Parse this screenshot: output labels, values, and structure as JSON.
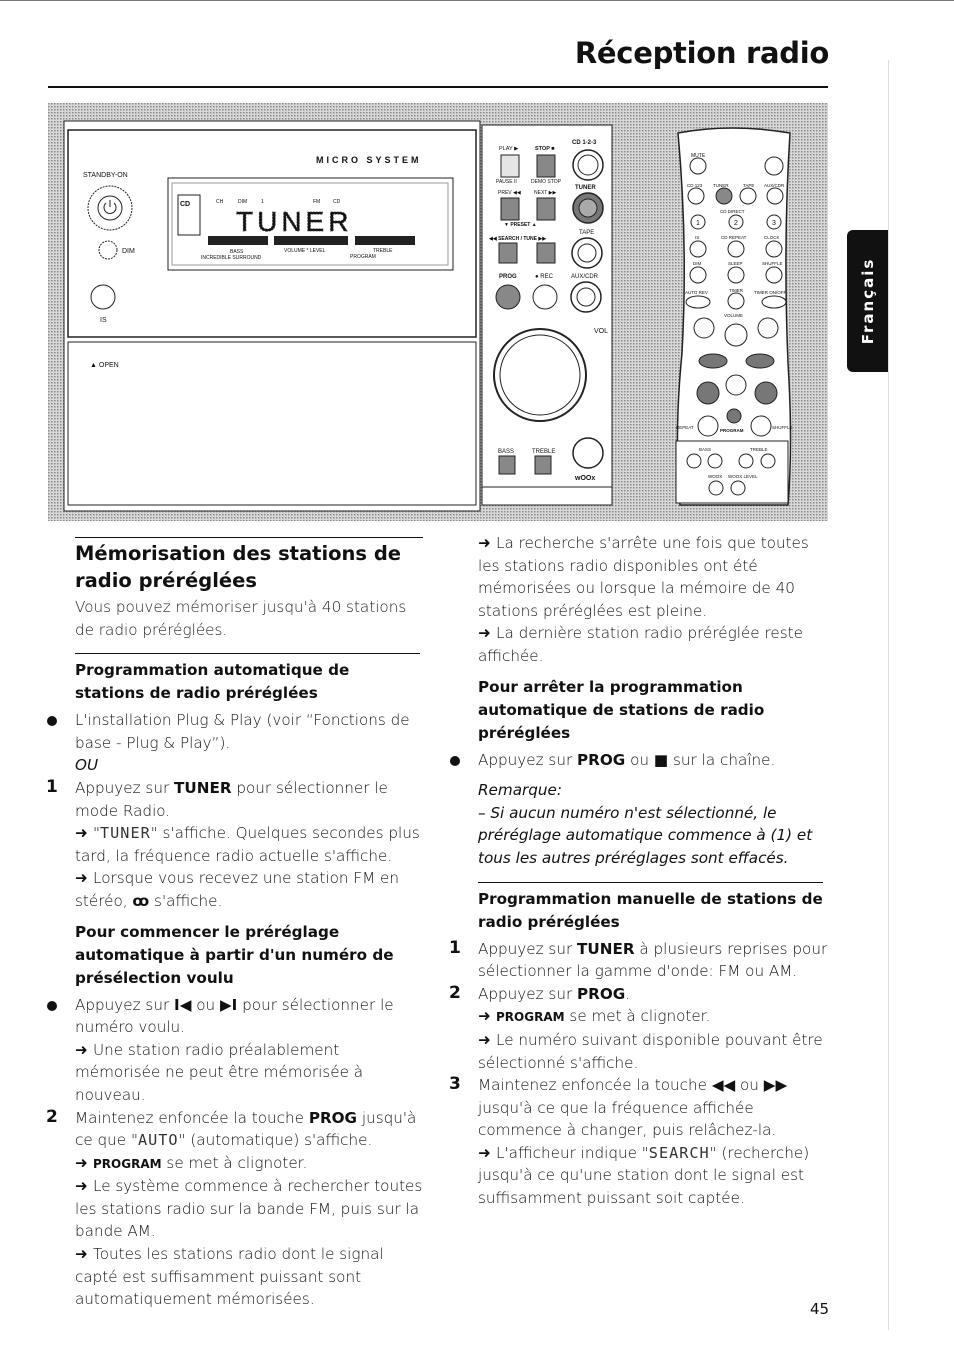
{
  "header": {
    "title": "Réception radio"
  },
  "side_tab": {
    "label": "Français"
  },
  "page_number": "45",
  "illustration": {
    "unit": {
      "brand_label": "MICRO SYSTEM",
      "standby": "STANDBY-ON",
      "dim": "DIM",
      "is": "IS",
      "open": "▲ OPEN",
      "display": {
        "text": "TUNER",
        "cd": "CD",
        "ind1": "CH",
        "ind2": "DIM",
        "ind3": "1",
        "fm": "FM",
        "stereo": "CD",
        "bass": "BASS",
        "surround": "INCREDIBLE SURROUND",
        "volume": "VOLUME * LEVEL",
        "treble": "TREBLE",
        "program": "PROGRAM"
      }
    },
    "panel": {
      "play": "PLAY ▶",
      "stop": "STOP ■",
      "cd123": "CD 1-2-3",
      "pause": "PAUSE II",
      "demo": "DEMO STOP",
      "tuner": "TUNER",
      "prev": "PREV ◀◀",
      "next": "NEXT ▶▶",
      "preset": "▼ PRESET ▲",
      "search": "◀◀ SEARCH / TUNE ▶▶",
      "tape": "TAPE",
      "prog": "PROG",
      "rec": "● REC",
      "aux": "AUX/CDR",
      "vol": "VOL",
      "bass": "BASS",
      "treble": "TREBLE",
      "woox": "wOOx"
    },
    "remote": {
      "mute": "MUTE",
      "cd123": "CD 123",
      "tuner": "TUNER",
      "tape": "TAPE",
      "aux": "AUX/CDR",
      "cd_direct": "CD DIRECT",
      "n1": "1",
      "n2": "2",
      "n3": "3",
      "is": "IS",
      "cd_repeat": "CD REPEAT",
      "clock": "CLOCK",
      "dim": "DIM",
      "sleep": "SLEEP",
      "shuffle_top": "SHUFFLE",
      "auto_rev": "AUTO REV",
      "timer": "TIMER",
      "timer_onoff": "TIMER ON/OFF",
      "volume": "VOLUME",
      "repeat": "REPEAT",
      "program": "PROGRAM",
      "shuffle": "SHUFFLE",
      "bass": "BASS",
      "treble": "TREBLE",
      "woox": "WOOX",
      "woox_level": "WOOX LEVEL"
    }
  },
  "left_column": [
    {
      "type": "h2",
      "parts": [
        {
          "t": "Mémorisation des stations de radio préréglées"
        }
      ]
    },
    {
      "type": "para",
      "parts": [
        {
          "t": "Vous pouvez mémoriser jusqu'à 40 stations de radio préréglées."
        }
      ]
    },
    {
      "type": "h3",
      "parts": [
        {
          "t": "Programmation automatique de stations de radio préréglées"
        }
      ]
    },
    {
      "type": "bullet",
      "parts": [
        {
          "t": "L'installation Plug & Play (voir “Fonctions de base - Plug & Play”)."
        }
      ]
    },
    {
      "type": "ital",
      "parts": [
        {
          "t": "OU"
        }
      ]
    },
    {
      "type": "step",
      "num": "1",
      "parts": [
        {
          "t": "Appuyez sur "
        },
        {
          "t": "TUNER",
          "s": "b"
        },
        {
          "t": " pour sélectionner le mode Radio."
        }
      ]
    },
    {
      "type": "arrow",
      "parts": [
        {
          "t": "\""
        },
        {
          "t": "TUNER",
          "s": "seg"
        },
        {
          "t": "\" s'affiche. Quelques secondes plus tard, la fréquence radio actuelle s'affiche."
        }
      ]
    },
    {
      "type": "arrow",
      "parts": [
        {
          "t": "Lorsque vous recevez une station FM en stéréo, "
        },
        {
          "t": "ꝏ",
          "s": "b"
        },
        {
          "t": " s'affiche."
        }
      ]
    },
    {
      "type": "h3n",
      "parts": [
        {
          "t": "Pour commencer le préréglage automatique à partir d'un numéro de présélection voulu"
        }
      ]
    },
    {
      "type": "bullet",
      "parts": [
        {
          "t": "Appuyez sur "
        },
        {
          "t": "I◀",
          "s": "b"
        },
        {
          "t": " ou "
        },
        {
          "t": "▶I",
          "s": "b"
        },
        {
          "t": " pour sélectionner le numéro voulu."
        }
      ]
    },
    {
      "type": "arrow",
      "parts": [
        {
          "t": "Une station radio préalablement mémorisée ne peut être mémorisée à nouveau."
        }
      ]
    },
    {
      "type": "step",
      "num": "2",
      "parts": [
        {
          "t": "Maintenez enfoncée la touche "
        },
        {
          "t": "PROG",
          "s": "b"
        },
        {
          "t": " jusqu'à ce que \""
        },
        {
          "t": "AUTO",
          "s": "seg"
        },
        {
          "t": "\" (automatique) s'affiche."
        }
      ]
    },
    {
      "type": "arrow",
      "parts": [
        {
          "t": "PROGRAM",
          "s": "sc"
        },
        {
          "t": " se met à clignoter."
        }
      ]
    },
    {
      "type": "arrow",
      "parts": [
        {
          "t": "Le système commence à rechercher toutes les stations radio sur la bande FM, puis sur la bande AM."
        }
      ]
    },
    {
      "type": "arrow",
      "parts": [
        {
          "t": "Toutes les stations radio dont le signal capté est suffisamment puissant sont automatiquement mémorisées."
        }
      ]
    }
  ],
  "right_column": [
    {
      "type": "arrow",
      "parts": [
        {
          "t": "La recherche s'arrête une fois que toutes les stations radio disponibles ont été mémorisées ou lorsque la mémoire de 40 stations préréglées est pleine."
        }
      ]
    },
    {
      "type": "arrow",
      "parts": [
        {
          "t": "La dernière station radio préréglée reste affichée."
        }
      ]
    },
    {
      "type": "h3n",
      "parts": [
        {
          "t": "Pour arrêter la programmation automatique de stations de radio préréglées"
        }
      ]
    },
    {
      "type": "bullet",
      "parts": [
        {
          "t": "Appuyez sur "
        },
        {
          "t": "PROG",
          "s": "b"
        },
        {
          "t": " ou "
        },
        {
          "t": "■",
          "s": "b"
        },
        {
          "t": " sur la chaîne."
        }
      ]
    },
    {
      "type": "ital note",
      "parts": [
        {
          "t": "Remarque:"
        }
      ]
    },
    {
      "type": "ital",
      "parts": [
        {
          "t": "– Si aucun numéro n'est sélectionné, le préréglage automatique commence à (1) et tous les autres préréglages sont effacés."
        }
      ]
    },
    {
      "type": "h3",
      "parts": [
        {
          "t": "Programmation manuelle de stations de radio préréglées"
        }
      ]
    },
    {
      "type": "step",
      "num": "1",
      "parts": [
        {
          "t": "Appuyez sur "
        },
        {
          "t": "TUNER",
          "s": "b"
        },
        {
          "t": " à plusieurs reprises pour sélectionner la gamme d'onde: FM ou AM."
        }
      ]
    },
    {
      "type": "step",
      "num": "2",
      "parts": [
        {
          "t": "Appuyez sur "
        },
        {
          "t": "PROG",
          "s": "b"
        },
        {
          "t": "."
        }
      ]
    },
    {
      "type": "arrow",
      "parts": [
        {
          "t": "PROGRAM",
          "s": "sc"
        },
        {
          "t": " se met à clignoter."
        }
      ]
    },
    {
      "type": "arrow",
      "parts": [
        {
          "t": "Le numéro suivant disponible pouvant être sélectionné s'affiche."
        }
      ]
    },
    {
      "type": "step",
      "num": "3",
      "parts": [
        {
          "t": "Maintenez enfoncée la touche "
        },
        {
          "t": "◀◀",
          "s": "b"
        },
        {
          "t": " ou "
        },
        {
          "t": "▶▶",
          "s": "b"
        },
        {
          "t": " jusqu'à ce que la fréquence affichée commence à changer, puis relâchez-la."
        }
      ]
    },
    {
      "type": "arrow",
      "parts": [
        {
          "t": "L'afficheur indique \""
        },
        {
          "t": "SEARCH",
          "s": "seg"
        },
        {
          "t": "\" (recherche) jusqu'à ce qu'une station dont le signal est suffisamment puissant soit captée."
        }
      ]
    }
  ]
}
